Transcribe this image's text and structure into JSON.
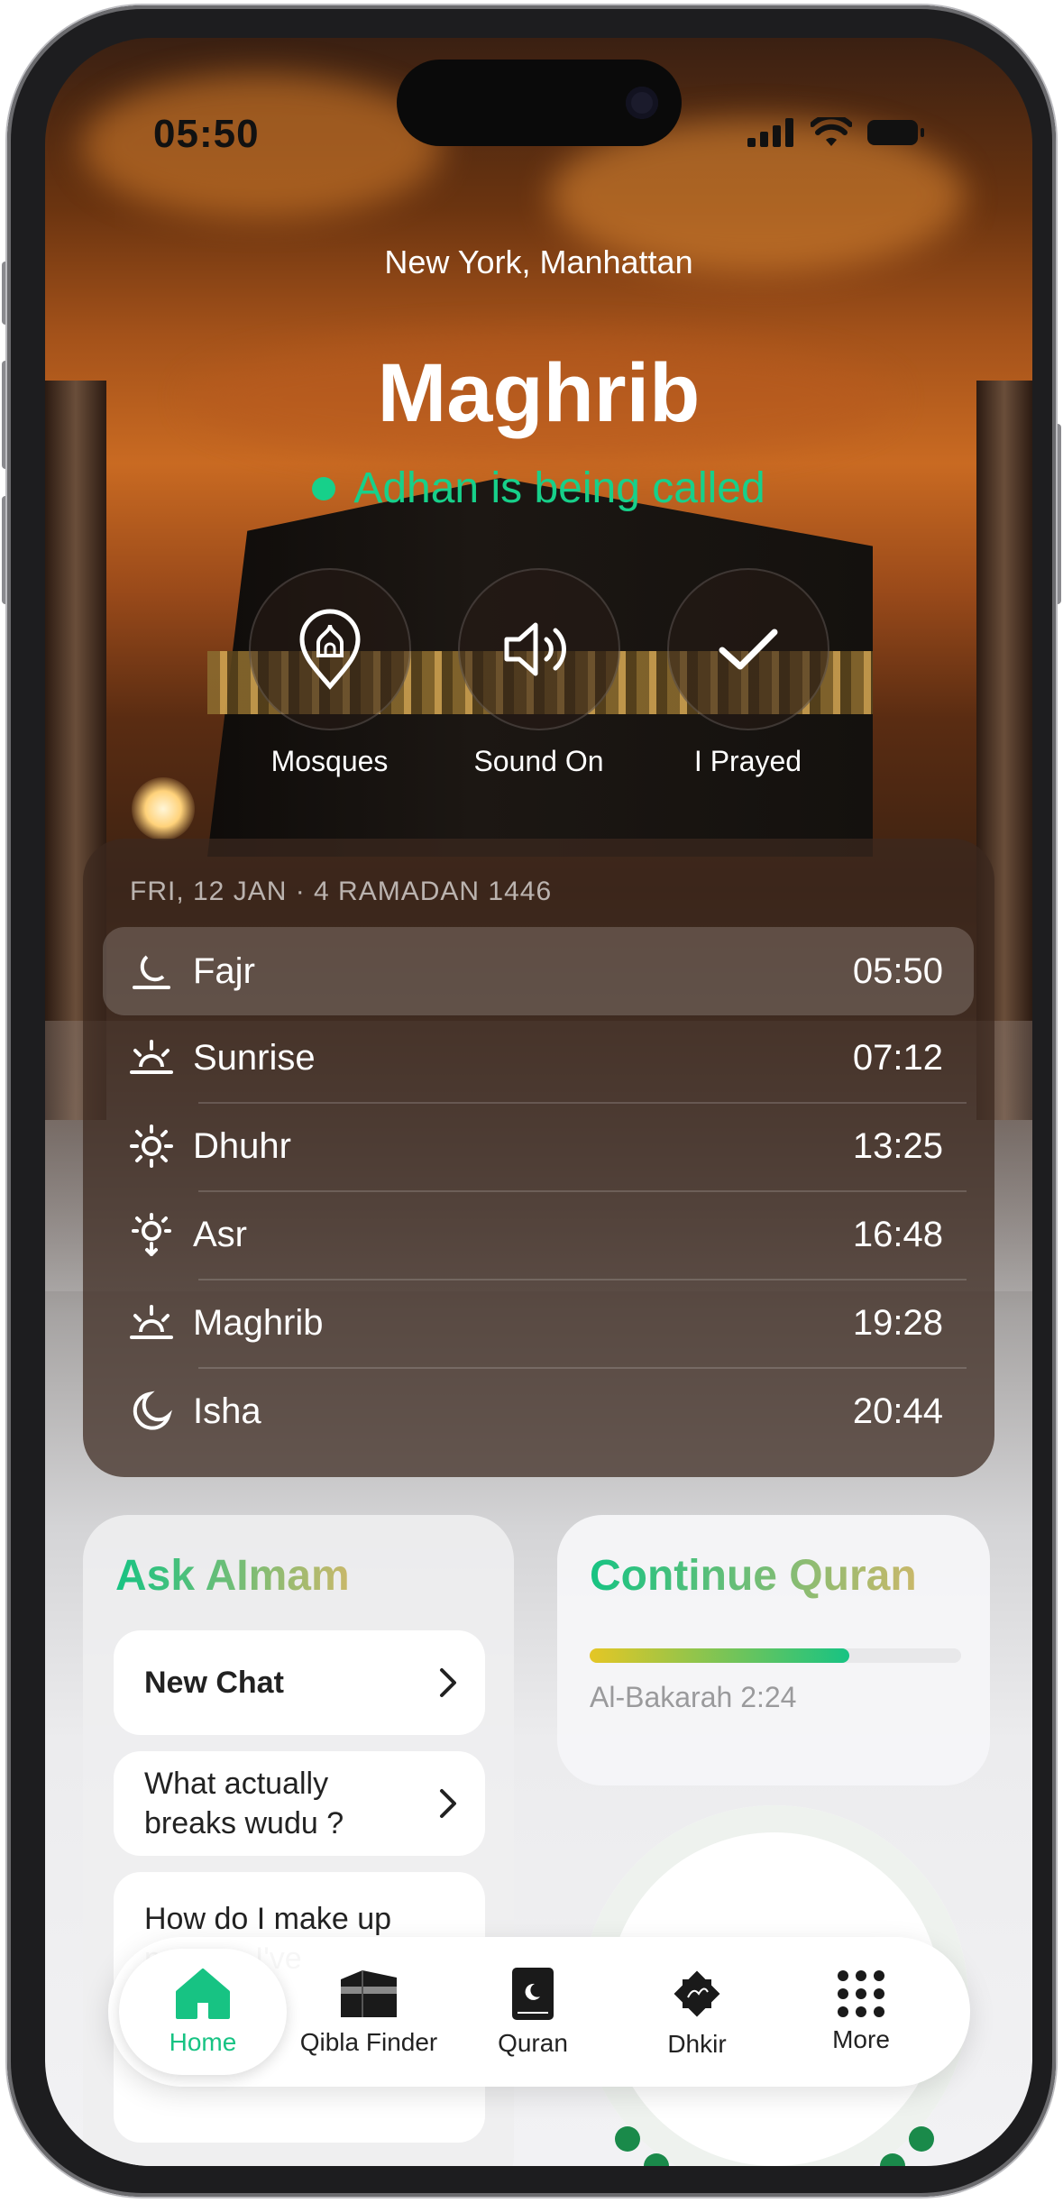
{
  "status_bar": {
    "time": "05:50"
  },
  "header": {
    "location": "New York, Manhattan",
    "current_prayer": "Maghrib",
    "status_text": "Adhan is being called"
  },
  "actions": [
    {
      "label": "Mosques",
      "icon": "mosque-pin-icon"
    },
    {
      "label": "Sound On",
      "icon": "speaker-icon"
    },
    {
      "label": "I Prayed",
      "icon": "checkmark-icon"
    }
  ],
  "prayer_times": {
    "date_line": "FRI, 12 JAN · 4 RAMADAN 1446",
    "rows": [
      {
        "name": "Fajr",
        "time": "05:50",
        "icon": "moon-horizon-icon",
        "active": true
      },
      {
        "name": "Sunrise",
        "time": "07:12",
        "icon": "sunrise-icon"
      },
      {
        "name": "Dhuhr",
        "time": "13:25",
        "icon": "sun-icon"
      },
      {
        "name": "Asr",
        "time": "16:48",
        "icon": "sun-down-icon"
      },
      {
        "name": "Maghrib",
        "time": "19:28",
        "icon": "sunset-icon"
      },
      {
        "name": "Isha",
        "time": "20:44",
        "icon": "moon-icon"
      }
    ]
  },
  "ask_imam": {
    "title": "Ask AImam",
    "items": [
      "New Chat",
      "What actually breaks wudu ?",
      "How do I make up prayers I've"
    ]
  },
  "continue_quran": {
    "title": "Continue Quran",
    "progress": 0.7,
    "surah": "Al-Bakarah 2:24"
  },
  "nav": [
    {
      "label": "Home",
      "icon": "home-icon",
      "active": true
    },
    {
      "label": "Qibla Finder",
      "icon": "kaaba-icon"
    },
    {
      "label": "Quran",
      "icon": "quran-book-icon"
    },
    {
      "label": "Dhkir",
      "icon": "dhikr-icon"
    },
    {
      "label": "More",
      "icon": "grid-dots-icon"
    }
  ],
  "colors": {
    "accent_green": "#17d08a",
    "nav_active": "#17c383",
    "progress_start": "#e5c625",
    "progress_end": "#17c383"
  }
}
